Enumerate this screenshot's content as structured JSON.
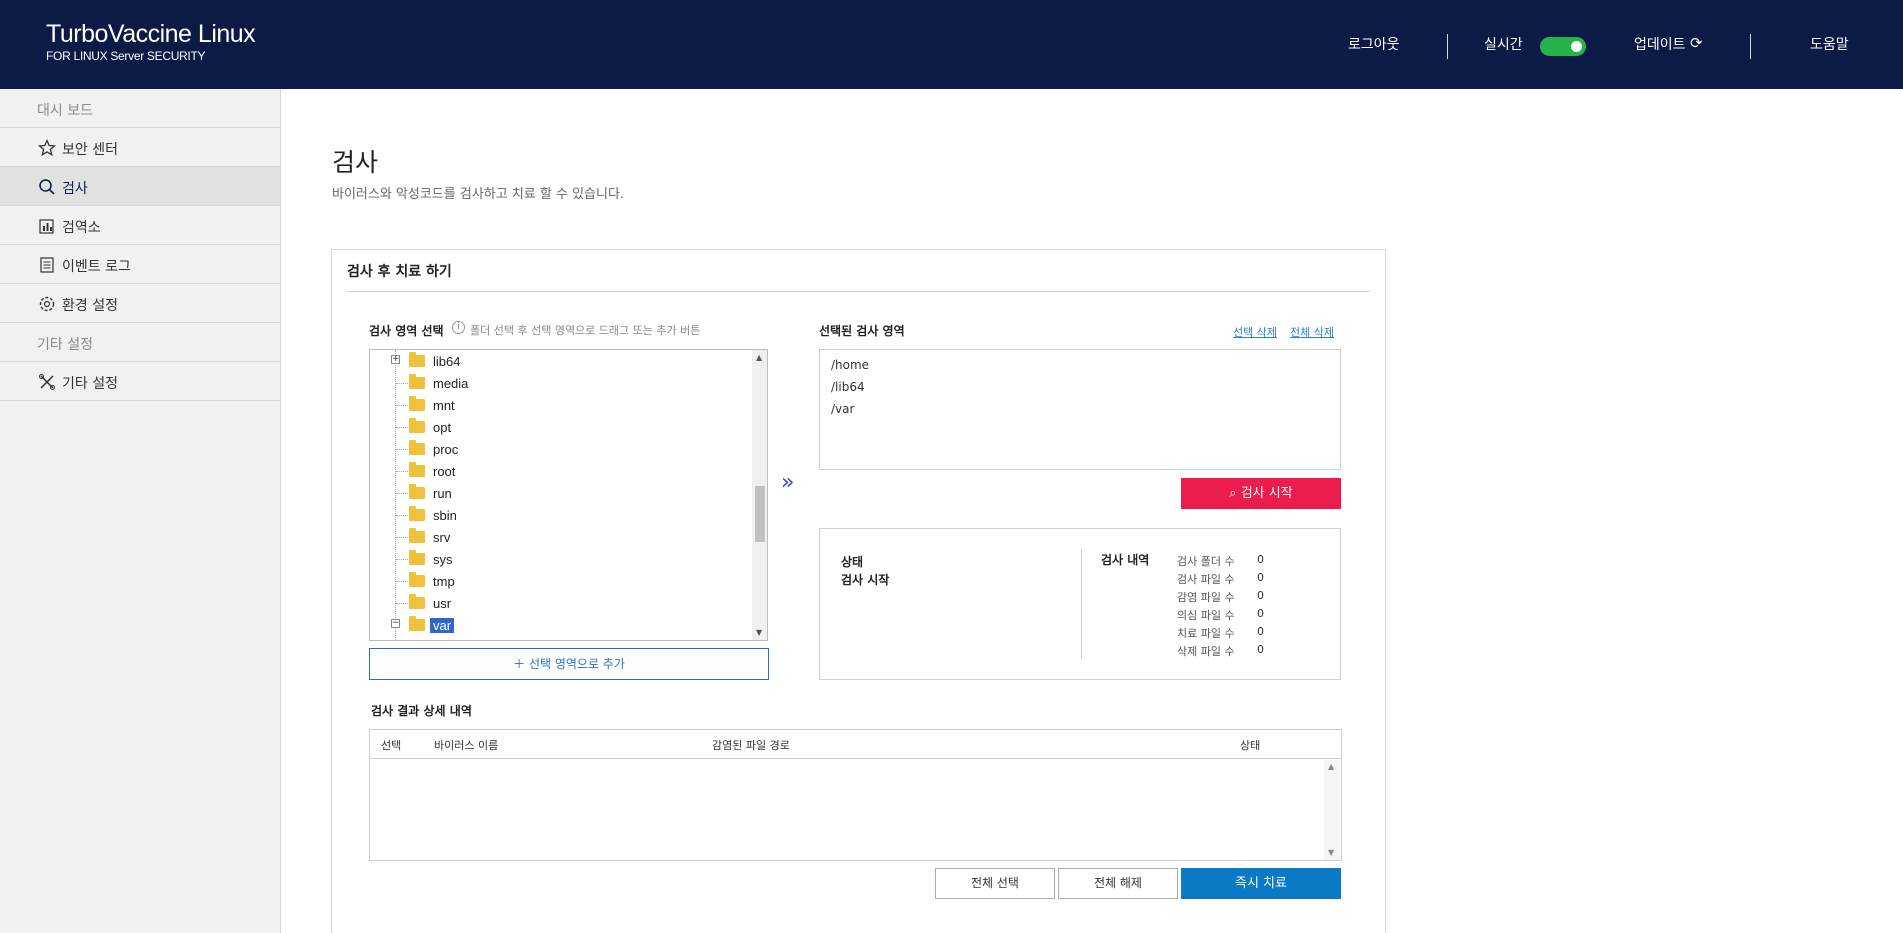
{
  "header": {
    "brand_title": "TurboVaccine Linux",
    "brand_subtitle": "FOR LINUX Server SECURITY",
    "logout": "로그아웃",
    "realtime": "실시간",
    "realtime_on": true,
    "update": "업데이트",
    "help": "도움말"
  },
  "sidebar": {
    "items": [
      {
        "label": "대시 보드",
        "type": "section"
      },
      {
        "label": "보안 센터",
        "icon": "star-icon"
      },
      {
        "label": "검사",
        "icon": "search-icon",
        "active": true
      },
      {
        "label": "검역소",
        "icon": "quarantine-icon"
      },
      {
        "label": "이벤트 로그",
        "icon": "log-icon"
      },
      {
        "label": "환경 설정",
        "icon": "gear-icon"
      },
      {
        "label": "기타 설정",
        "type": "section"
      },
      {
        "label": "기타 설정",
        "icon": "tools-icon"
      }
    ]
  },
  "main": {
    "title": "검사",
    "description": "바이러스와 악성코드를 검사하고 치료 할 수 있습니다.",
    "panel_title": "검사 후 치료 하기",
    "scan_area_title": "검사 영역 선택",
    "scan_area_hint": "폴더 선택 후 선택 영역으로 드래그 또는 추가 버튼",
    "tree": [
      {
        "name": "lib64",
        "expander": "+"
      },
      {
        "name": "media"
      },
      {
        "name": "mnt"
      },
      {
        "name": "opt"
      },
      {
        "name": "proc"
      },
      {
        "name": "root"
      },
      {
        "name": "run"
      },
      {
        "name": "sbin"
      },
      {
        "name": "srv"
      },
      {
        "name": "sys"
      },
      {
        "name": "tmp"
      },
      {
        "name": "usr"
      },
      {
        "name": "var",
        "expander": "−",
        "selected": true
      }
    ],
    "add_button": "선택 영역으로 추가",
    "selected_title": "선택된 검사 영역",
    "delete_selected": "선택 삭제",
    "delete_all": "전체 삭제",
    "selected_paths": [
      "/home",
      "/lib64",
      "/var"
    ],
    "scan_start": "검사 시작",
    "status": {
      "state_label": "상태",
      "scan_start_label": "검사 시작",
      "history_label": "검사 내역",
      "rows": [
        {
          "label": "검사 폴더 수",
          "value": "0"
        },
        {
          "label": "검사 파일 수",
          "value": "0"
        },
        {
          "label": "감염 파일 수",
          "value": "0"
        },
        {
          "label": "의심 파일 수",
          "value": "0"
        },
        {
          "label": "치료 파일 수",
          "value": "0"
        },
        {
          "label": "삭제 파일 수",
          "value": "0"
        }
      ]
    },
    "result_title": "검사 결과 상세 내역",
    "result_columns": [
      "선택",
      "바이러스 이름",
      "감염된 파일 경로",
      "상태"
    ],
    "select_all": "전체 선택",
    "deselect_all": "전체 해제",
    "heal_now": "즉시 치료"
  }
}
